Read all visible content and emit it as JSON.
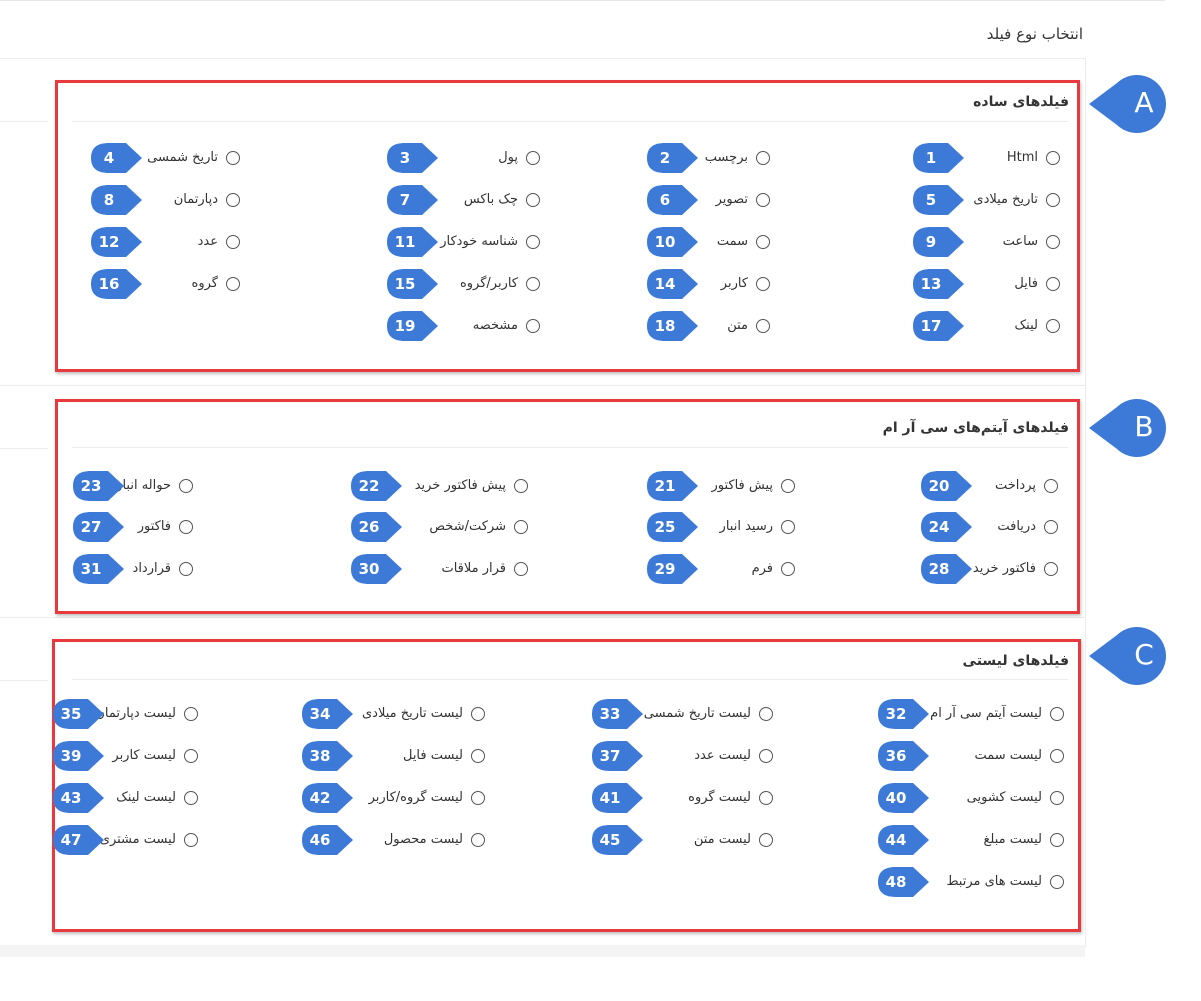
{
  "page_title": "انتخاب نوع فیلد",
  "colors": {
    "highlight": "#e8393f",
    "marker": "#3d7ad8"
  },
  "sections": [
    {
      "key": "A",
      "title": "فیلدهای ساده",
      "items": [
        {
          "num": "1",
          "label": "Html"
        },
        {
          "num": "2",
          "label": "برچسب"
        },
        {
          "num": "3",
          "label": "پول"
        },
        {
          "num": "4",
          "label": "تاریخ شمسی"
        },
        {
          "num": "5",
          "label": "تاریخ میلادی"
        },
        {
          "num": "6",
          "label": "تصویر"
        },
        {
          "num": "7",
          "label": "چک باکس"
        },
        {
          "num": "8",
          "label": "دپارتمان"
        },
        {
          "num": "9",
          "label": "ساعت"
        },
        {
          "num": "10",
          "label": "سمت"
        },
        {
          "num": "11",
          "label": "شناسه خودکار"
        },
        {
          "num": "12",
          "label": "عدد"
        },
        {
          "num": "13",
          "label": "فایل"
        },
        {
          "num": "14",
          "label": "کاربر"
        },
        {
          "num": "15",
          "label": "کاربر/گروه"
        },
        {
          "num": "16",
          "label": "گروه"
        },
        {
          "num": "17",
          "label": "لینک"
        },
        {
          "num": "18",
          "label": "متن"
        },
        {
          "num": "19",
          "label": "مشخصه"
        }
      ]
    },
    {
      "key": "B",
      "title": "فیلدهای آیتم‌های سی آر ام",
      "items": [
        {
          "num": "20",
          "label": "پرداخت"
        },
        {
          "num": "21",
          "label": "پیش فاکتور"
        },
        {
          "num": "22",
          "label": "پیش فاکتور خرید"
        },
        {
          "num": "23",
          "label": "حواله انبار"
        },
        {
          "num": "24",
          "label": "دریافت"
        },
        {
          "num": "25",
          "label": "رسید انبار"
        },
        {
          "num": "26",
          "label": "شرکت/شخص"
        },
        {
          "num": "27",
          "label": "فاکتور"
        },
        {
          "num": "28",
          "label": "فاکتور خرید"
        },
        {
          "num": "29",
          "label": "فرم"
        },
        {
          "num": "30",
          "label": "قرار ملاقات"
        },
        {
          "num": "31",
          "label": "قرارداد"
        }
      ]
    },
    {
      "key": "C",
      "title": "فیلدهای لیستی",
      "items": [
        {
          "num": "32",
          "label": "لیست آیتم سی آر ام"
        },
        {
          "num": "33",
          "label": "لیست تاریخ شمسی"
        },
        {
          "num": "34",
          "label": "لیست تاریخ میلادی"
        },
        {
          "num": "35",
          "label": "لیست دپارتمان"
        },
        {
          "num": "36",
          "label": "لیست سمت"
        },
        {
          "num": "37",
          "label": "لیست عدد"
        },
        {
          "num": "38",
          "label": "لیست فایل"
        },
        {
          "num": "39",
          "label": "لیست کاربر"
        },
        {
          "num": "40",
          "label": "لیست کشویی"
        },
        {
          "num": "41",
          "label": "لیست گروه"
        },
        {
          "num": "42",
          "label": "لیست گروه/کاربر"
        },
        {
          "num": "43",
          "label": "لیست لینک"
        },
        {
          "num": "44",
          "label": "لیست مبلغ"
        },
        {
          "num": "45",
          "label": "لیست متن"
        },
        {
          "num": "46",
          "label": "لیست محصول"
        },
        {
          "num": "47",
          "label": "لیست مشتری"
        },
        {
          "num": "48",
          "label": "لیست های مرتبط"
        }
      ]
    }
  ]
}
